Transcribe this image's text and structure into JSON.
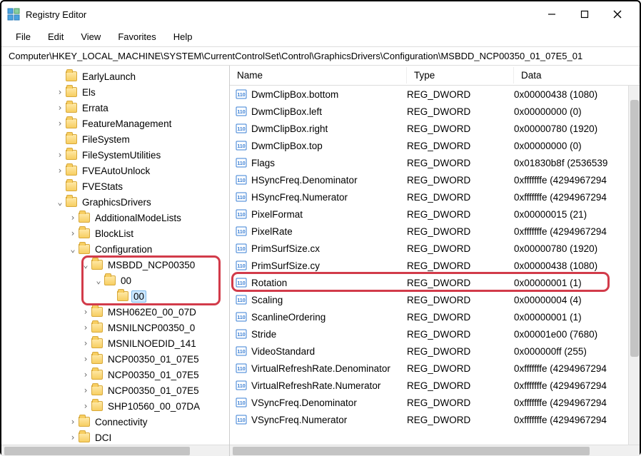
{
  "window": {
    "title": "Registry Editor"
  },
  "menu": {
    "file": "File",
    "edit": "Edit",
    "view": "View",
    "favorites": "Favorites",
    "help": "Help"
  },
  "address": "Computer\\HKEY_LOCAL_MACHINE\\SYSTEM\\CurrentControlSet\\Control\\GraphicsDrivers\\Configuration\\MSBDD_NCP00350_01_07E5_01",
  "tree": {
    "items": [
      {
        "indent": 3,
        "exp": "",
        "label": "EarlyLaunch"
      },
      {
        "indent": 3,
        "exp": ">",
        "label": "Els"
      },
      {
        "indent": 3,
        "exp": ">",
        "label": "Errata"
      },
      {
        "indent": 3,
        "exp": ">",
        "label": "FeatureManagement"
      },
      {
        "indent": 3,
        "exp": "",
        "label": "FileSystem"
      },
      {
        "indent": 3,
        "exp": ">",
        "label": "FileSystemUtilities"
      },
      {
        "indent": 3,
        "exp": ">",
        "label": "FVEAutoUnlock"
      },
      {
        "indent": 3,
        "exp": "",
        "label": "FVEStats"
      },
      {
        "indent": 3,
        "exp": "v",
        "label": "GraphicsDrivers"
      },
      {
        "indent": 4,
        "exp": ">",
        "label": "AdditionalModeLists"
      },
      {
        "indent": 4,
        "exp": ">",
        "label": "BlockList"
      },
      {
        "indent": 4,
        "exp": "v",
        "label": "Configuration"
      },
      {
        "indent": 5,
        "exp": "v",
        "label": "MSBDD_NCP00350"
      },
      {
        "indent": 6,
        "exp": "v",
        "label": "00"
      },
      {
        "indent": 7,
        "exp": "",
        "label": "00",
        "selected": true
      },
      {
        "indent": 5,
        "exp": ">",
        "label": "MSH062E0_00_07D"
      },
      {
        "indent": 5,
        "exp": ">",
        "label": "MSNILNCP00350_0"
      },
      {
        "indent": 5,
        "exp": ">",
        "label": "MSNILNOEDID_141"
      },
      {
        "indent": 5,
        "exp": ">",
        "label": "NCP00350_01_07E5"
      },
      {
        "indent": 5,
        "exp": ">",
        "label": "NCP00350_01_07E5"
      },
      {
        "indent": 5,
        "exp": ">",
        "label": "NCP00350_01_07E5"
      },
      {
        "indent": 5,
        "exp": ">",
        "label": "SHP10560_00_07DA"
      },
      {
        "indent": 4,
        "exp": ">",
        "label": "Connectivity"
      },
      {
        "indent": 4,
        "exp": ">",
        "label": "DCI"
      }
    ]
  },
  "columns": {
    "name": "Name",
    "type": "Type",
    "data": "Data"
  },
  "values": [
    {
      "name": "DwmClipBox.bottom",
      "type": "REG_DWORD",
      "data": "0x00000438 (1080)"
    },
    {
      "name": "DwmClipBox.left",
      "type": "REG_DWORD",
      "data": "0x00000000 (0)"
    },
    {
      "name": "DwmClipBox.right",
      "type": "REG_DWORD",
      "data": "0x00000780 (1920)"
    },
    {
      "name": "DwmClipBox.top",
      "type": "REG_DWORD",
      "data": "0x00000000 (0)"
    },
    {
      "name": "Flags",
      "type": "REG_DWORD",
      "data": "0x01830b8f (2536539"
    },
    {
      "name": "HSyncFreq.Denominator",
      "type": "REG_DWORD",
      "data": "0xfffffffe (4294967294"
    },
    {
      "name": "HSyncFreq.Numerator",
      "type": "REG_DWORD",
      "data": "0xfffffffe (4294967294"
    },
    {
      "name": "PixelFormat",
      "type": "REG_DWORD",
      "data": "0x00000015 (21)"
    },
    {
      "name": "PixelRate",
      "type": "REG_DWORD",
      "data": "0xfffffffe (4294967294"
    },
    {
      "name": "PrimSurfSize.cx",
      "type": "REG_DWORD",
      "data": "0x00000780 (1920)"
    },
    {
      "name": "PrimSurfSize.cy",
      "type": "REG_DWORD",
      "data": "0x00000438 (1080)"
    },
    {
      "name": "Rotation",
      "type": "REG_DWORD",
      "data": "0x00000001 (1)"
    },
    {
      "name": "Scaling",
      "type": "REG_DWORD",
      "data": "0x00000004 (4)"
    },
    {
      "name": "ScanlineOrdering",
      "type": "REG_DWORD",
      "data": "0x00000001 (1)"
    },
    {
      "name": "Stride",
      "type": "REG_DWORD",
      "data": "0x00001e00 (7680)"
    },
    {
      "name": "VideoStandard",
      "type": "REG_DWORD",
      "data": "0x000000ff (255)"
    },
    {
      "name": "VirtualRefreshRate.Denominator",
      "type": "REG_DWORD",
      "data": "0xfffffffe (4294967294"
    },
    {
      "name": "VirtualRefreshRate.Numerator",
      "type": "REG_DWORD",
      "data": "0xfffffffe (4294967294"
    },
    {
      "name": "VSyncFreq.Denominator",
      "type": "REG_DWORD",
      "data": "0xfffffffe (4294967294"
    },
    {
      "name": "VSyncFreq.Numerator",
      "type": "REG_DWORD",
      "data": "0xfffffffe (4294967294"
    }
  ]
}
